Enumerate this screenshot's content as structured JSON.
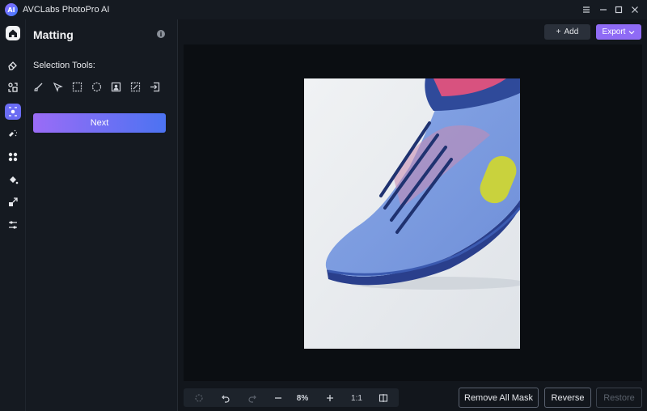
{
  "titlebar": {
    "logo_text": "AI",
    "title": "AVCLabs PhotoPro AI"
  },
  "panel": {
    "title": "Matting",
    "selection_label": "Selection Tools:",
    "next_label": "Next"
  },
  "actions": {
    "add_label": "Add",
    "add_icon": "+",
    "export_label": "Export"
  },
  "bottom": {
    "zoom": "8%",
    "actual_size": "1:1",
    "remove_all_mask": "Remove All Mask",
    "reverse": "Reverse",
    "restore": "Restore"
  },
  "colors": {
    "accent": "#8f6bf5",
    "active_rail": "#6a6cf3",
    "canvas_bg": "#0b0e12"
  }
}
